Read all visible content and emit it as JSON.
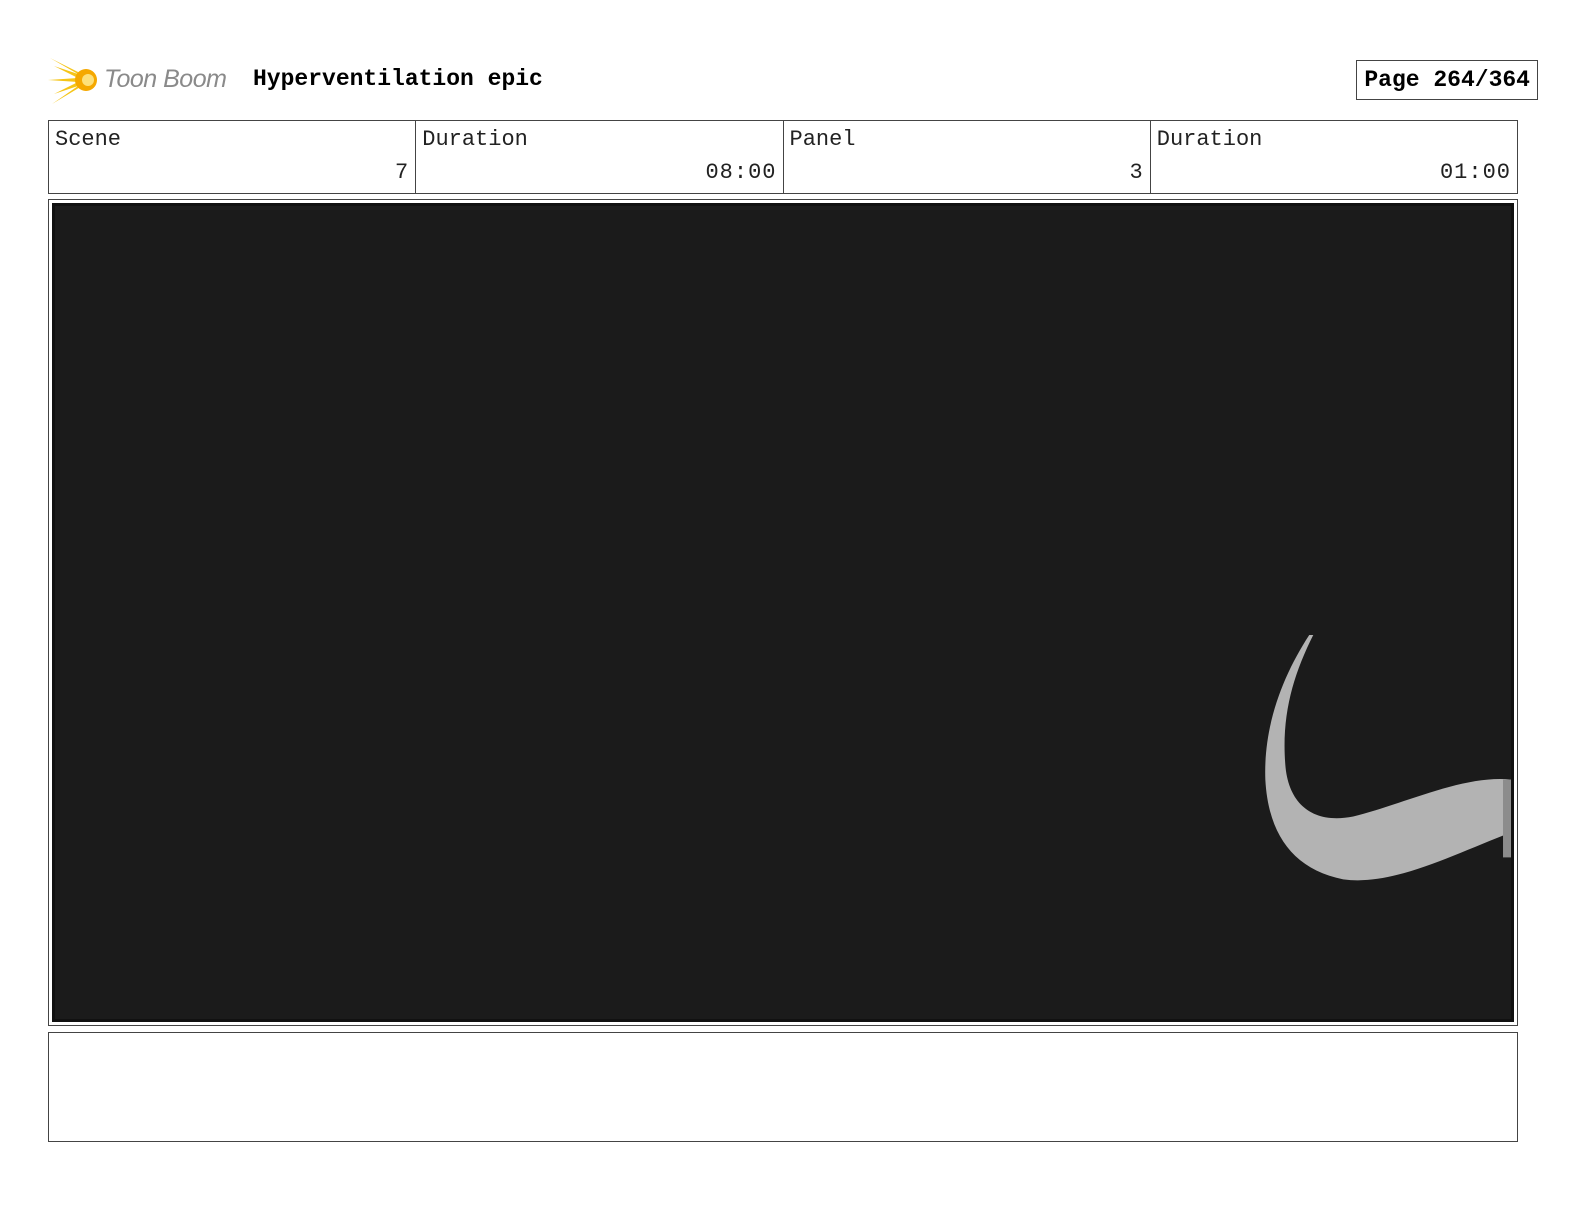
{
  "header": {
    "logo_text": "Toon Boom",
    "title": "Hyperventilation epic",
    "page_label": "Page 264/364"
  },
  "info": {
    "scene_label": "Scene",
    "scene_value": "7",
    "scene_duration_label": "Duration",
    "scene_duration_value": "08:00",
    "panel_label": "Panel",
    "panel_value": "3",
    "panel_duration_label": "Duration",
    "panel_duration_value": "01:00"
  },
  "panel": {
    "background_color": "#1b1b1b",
    "shape_color": "#b3b3b3",
    "logo_accent_color": "#f5c518"
  },
  "notes": {
    "text": ""
  }
}
